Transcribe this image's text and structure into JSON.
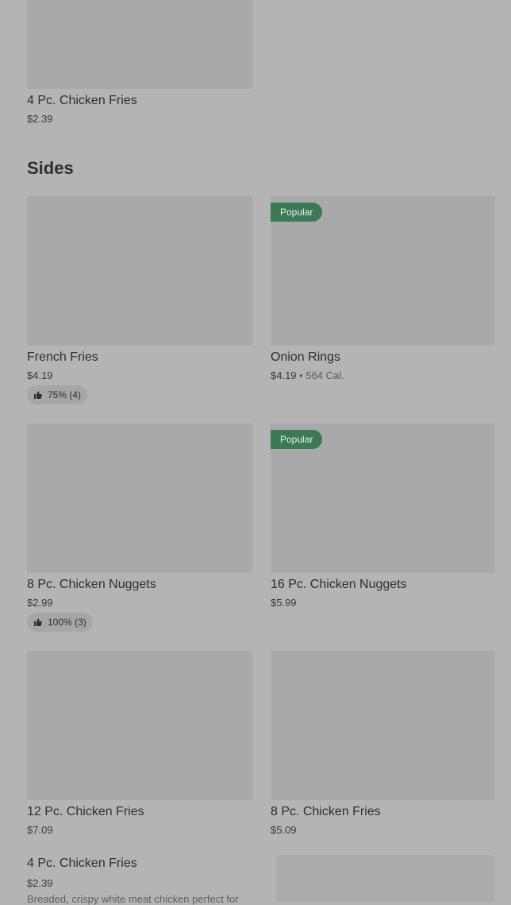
{
  "top_item": {
    "name": "4 Pc. Chicken Fries",
    "price": "$2.39"
  },
  "section": {
    "title": "Sides"
  },
  "badge_label": "Popular",
  "items": [
    {
      "name": "French Fries",
      "price": "$4.19",
      "rating": "75% (4)"
    },
    {
      "name": "Onion Rings",
      "price": "$4.19",
      "calories": "564 Cal.",
      "popular": true
    },
    {
      "name": "8 Pc. Chicken Nuggets",
      "price": "$2.99",
      "rating": "100% (3)"
    },
    {
      "name": "16 Pc. Chicken Nuggets",
      "price": "$5.99",
      "popular": true
    },
    {
      "name": "12 Pc. Chicken Fries",
      "price": "$7.09"
    },
    {
      "name": "8 Pc. Chicken Fries",
      "price": "$5.09"
    }
  ],
  "list_item": {
    "name": "4 Pc. Chicken Fries",
    "price": "$2.39",
    "description": "Breaded, crispy white meat chicken perfect for"
  },
  "colors": {
    "popular_badge": "#3b7a55"
  }
}
